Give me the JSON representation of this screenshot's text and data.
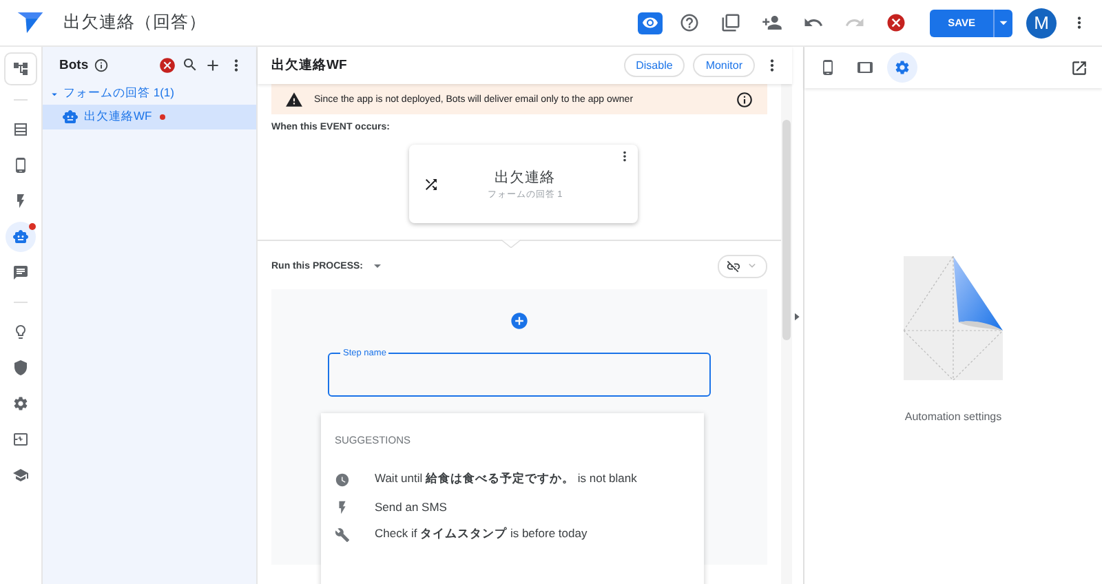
{
  "app": {
    "title": "出欠連絡（回答）"
  },
  "toolbar": [
    {
      "kind": "preview",
      "selected": true,
      "disabled": false
    },
    {
      "kind": "help",
      "selected": false,
      "disabled": false
    },
    {
      "kind": "copy",
      "selected": false,
      "disabled": false
    },
    {
      "kind": "share",
      "selected": false,
      "disabled": false
    },
    {
      "kind": "undo",
      "selected": false,
      "disabled": false
    },
    {
      "kind": "redo",
      "selected": false,
      "disabled": true
    },
    {
      "kind": "error",
      "selected": false,
      "disabled": false
    }
  ],
  "save_button": {
    "label": "SAVE"
  },
  "avatar": {
    "initial": "M"
  },
  "rail": [
    {
      "kind": "flow",
      "selected": false,
      "badge": false
    },
    {
      "kind": "divider"
    },
    {
      "kind": "table",
      "selected": false,
      "badge": false
    },
    {
      "kind": "phone",
      "selected": false,
      "badge": false
    },
    {
      "kind": "bolt",
      "selected": false,
      "badge": false
    },
    {
      "kind": "bot",
      "selected": true,
      "badge": true
    },
    {
      "kind": "chat",
      "selected": false,
      "badge": false
    },
    {
      "kind": "divider"
    },
    {
      "kind": "bulb",
      "selected": false,
      "badge": false
    },
    {
      "kind": "shield",
      "selected": false,
      "badge": false
    },
    {
      "kind": "settings",
      "selected": false,
      "badge": false
    },
    {
      "kind": "monitor",
      "selected": false,
      "badge": false
    },
    {
      "kind": "school",
      "selected": false,
      "badge": false
    }
  ],
  "bots": {
    "title": "Bots",
    "group": {
      "label": "フォームの回答 1(1)",
      "expanded": true,
      "items": [
        {
          "label": "出欠連絡WF",
          "selected": true,
          "has_error": true
        }
      ]
    }
  },
  "editor": {
    "title": "出欠連絡WF",
    "buttons": [
      "Disable",
      "Monitor"
    ],
    "warning": "Since the app is not deployed, Bots will deliver email only to the app owner",
    "event_label": "When this EVENT occurs:",
    "event": {
      "title": "出欠連絡",
      "subtitle": "フォームの回答 1"
    },
    "process_label": "Run this PROCESS:",
    "process_toggle": {
      "on": false
    },
    "step_field": {
      "label": "Step name"
    },
    "suggestions": {
      "heading": "SUGGESTIONS",
      "items": [
        {
          "kind": "clock",
          "text": "Wait until **給食は食べる予定ですか。** is not blank"
        },
        {
          "kind": "bolt",
          "text": "Send an SMS"
        },
        {
          "kind": "wrench",
          "text": "Check if **タイムスタンプ** is before today"
        }
      ]
    }
  },
  "right_panel": {
    "tabs": [
      {
        "kind": "phone",
        "selected": false
      },
      {
        "kind": "tablet",
        "selected": false
      },
      {
        "kind": "settings",
        "selected": true
      }
    ],
    "caption": "Automation settings"
  }
}
